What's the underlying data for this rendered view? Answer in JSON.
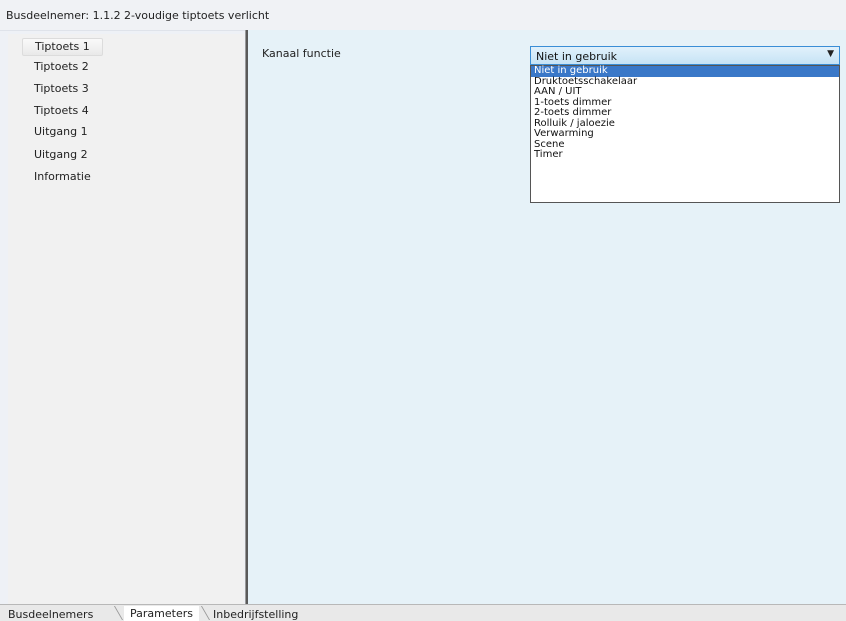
{
  "window": {
    "title": "Busdeelnemer: 1.1.2  2-voudige tiptoets verlicht"
  },
  "sidebar": {
    "items": [
      {
        "label": "Tiptoets 1",
        "selected": true
      },
      {
        "label": "Tiptoets 2"
      },
      {
        "label": "Tiptoets 3"
      },
      {
        "label": "Tiptoets 4"
      },
      {
        "label": "Uitgang 1"
      },
      {
        "label": "Uitgang 2"
      },
      {
        "label": "Informatie"
      }
    ]
  },
  "main": {
    "parameter_label": "Kanaal functie",
    "combo": {
      "value": "Niet in gebruik",
      "arrow_icon": "chevron-down-icon",
      "options": [
        "Niet in gebruik",
        "Druktoetsschakelaar",
        "AAN / UIT",
        "1-toets dimmer",
        "2-toets dimmer",
        "Rolluik / jaloezie",
        "Verwarming",
        "Scene",
        "Timer"
      ],
      "selected_index": 0
    }
  },
  "tabs": [
    {
      "label": "Busdeelnemers"
    },
    {
      "label": "Parameters",
      "active": true
    },
    {
      "label": "Inbedrijfstelling"
    }
  ],
  "colors": {
    "main_background": "#e6f2f8",
    "selection": "#3a78c8",
    "combo_border": "#3a8ed6"
  }
}
